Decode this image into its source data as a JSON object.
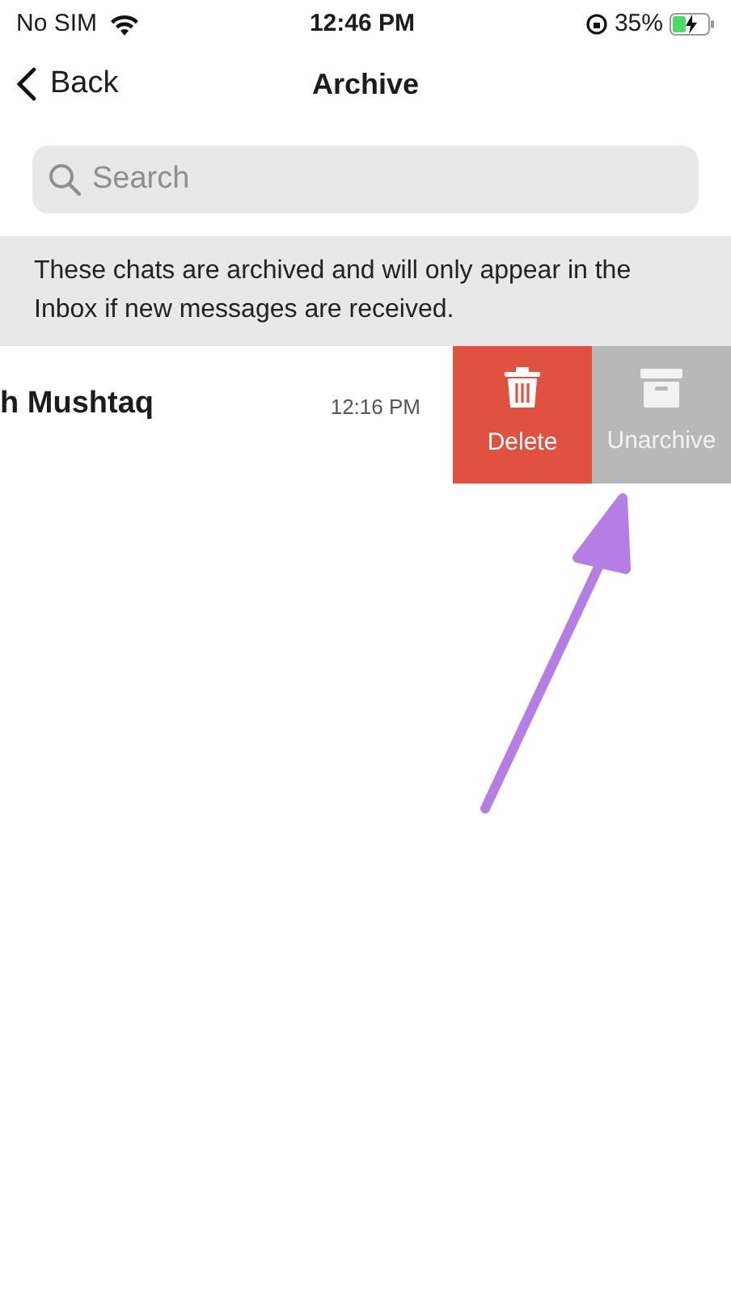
{
  "status_bar": {
    "carrier": "No SIM",
    "time": "12:46 PM",
    "battery": "35%"
  },
  "nav": {
    "back": "Back",
    "title": "Archive"
  },
  "search": {
    "placeholder": "Search"
  },
  "notice": "These chats are archived and will only appear in the Inbox if new messages are received.",
  "chats": [
    {
      "name": "h Mushtaq",
      "time": "12:16 PM",
      "actions": [
        {
          "kind": "delete",
          "label": "Delete"
        },
        {
          "kind": "unarchive",
          "label": "Unarchive"
        }
      ]
    }
  ]
}
